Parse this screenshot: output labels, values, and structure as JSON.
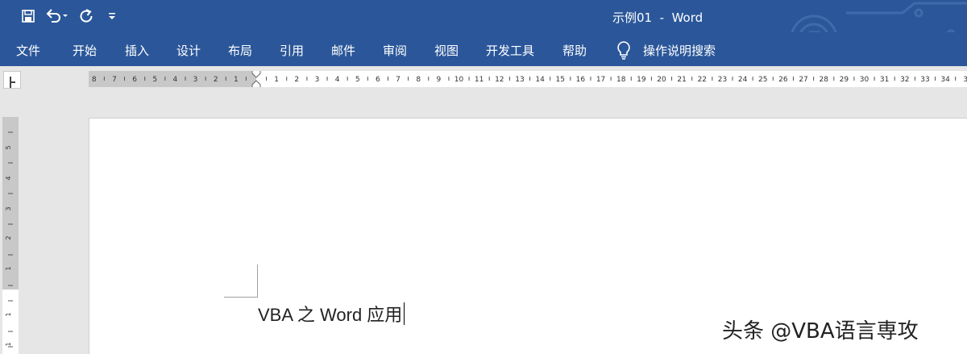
{
  "window": {
    "title": "示例01  -  Word"
  },
  "qat": {
    "save_icon": "save-icon",
    "undo_icon": "undo-icon",
    "redo_icon": "repeat-icon",
    "customize_icon": "customize-qat-icon"
  },
  "ribbon": {
    "tabs": [
      {
        "label": "文件"
      },
      {
        "label": "开始"
      },
      {
        "label": "插入"
      },
      {
        "label": "设计"
      },
      {
        "label": "布局"
      },
      {
        "label": "引用"
      },
      {
        "label": "邮件"
      },
      {
        "label": "审阅"
      },
      {
        "label": "视图"
      },
      {
        "label": "开发工具"
      },
      {
        "label": "帮助"
      }
    ],
    "tell_me": {
      "icon": "lightbulb-icon",
      "label": "操作说明搜索"
    }
  },
  "ruler": {
    "left_numbers": [
      "8",
      "7",
      "6",
      "5",
      "4",
      "3",
      "2",
      "1"
    ],
    "right_numbers": [
      "1",
      "2",
      "3",
      "4",
      "5",
      "6",
      "7",
      "8",
      "9",
      "10",
      "11",
      "12",
      "13",
      "14",
      "15",
      "16",
      "17",
      "18",
      "19",
      "20",
      "21",
      "22",
      "23",
      "24",
      "25",
      "26",
      "27",
      "28",
      "29",
      "30",
      "31",
      "32",
      "33",
      "34",
      "3"
    ],
    "vertical_numbers": [
      "5",
      "4",
      "3",
      "2",
      "1",
      "1",
      "1"
    ]
  },
  "document": {
    "text": "VBA 之 Word 应用"
  },
  "watermark": {
    "text": "头条 @VBA语言専攻"
  },
  "colors": {
    "ribbon_blue": "#2b579a",
    "ruler_gray": "#c8c8c8",
    "background": "#e6e6e6"
  }
}
